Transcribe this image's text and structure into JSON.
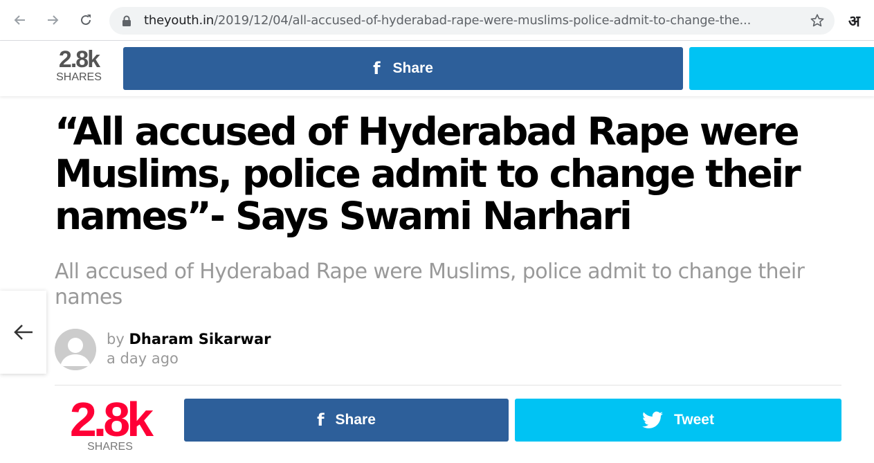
{
  "browser": {
    "url_host": "theyouth.in",
    "url_path": "/2019/12/04/all-accused-of-hyderabad-rape-were-muslims-police-admit-to-change-the...",
    "translate_label": "अ"
  },
  "sticky_bar": {
    "share_count": "2.8k",
    "share_count_label": "SHARES",
    "facebook_label": "Share"
  },
  "article": {
    "headline": "“All accused of Hyderabad Rape were Muslims, police admit to change their names”- Says Swami Narhari",
    "subtitle": "All accused of Hyderabad Rape were Muslims, police admit to change their names",
    "by_prefix": "by",
    "author": "Dharam Sikarwar",
    "date": "a day ago"
  },
  "share_area": {
    "share_count": "2.8k",
    "share_count_label": "SHARES",
    "facebook_label": "Share",
    "twitter_label": "Tweet"
  },
  "icons": {
    "back": "arrow-left-icon",
    "forward": "arrow-right-icon",
    "reload": "reload-icon",
    "lock": "lock-icon",
    "bookmark": "star-icon",
    "facebook": "facebook-icon",
    "twitter": "twitter-icon"
  },
  "colors": {
    "facebook": "#2d5f9a",
    "twitter": "#00c3f3",
    "share_count": "#ff0036"
  }
}
